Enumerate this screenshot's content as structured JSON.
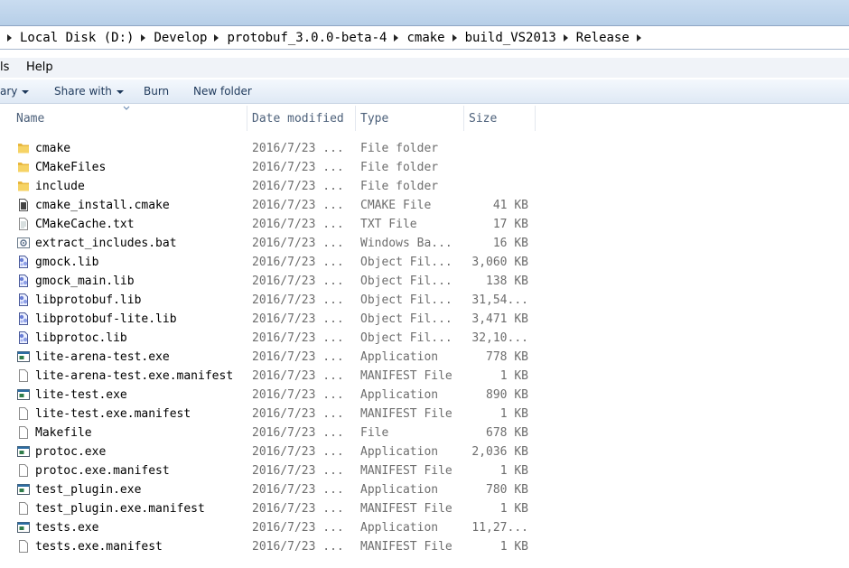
{
  "breadcrumb": [
    "Local Disk (D:)",
    "Develop",
    "protobuf_3.0.0-beta-4",
    "cmake",
    "build_VS2013",
    "Release"
  ],
  "menu": {
    "tools_partial": "ls",
    "help": "Help"
  },
  "toolbar": {
    "library_partial": "ary",
    "share_with": "Share with",
    "burn": "Burn",
    "new_folder": "New folder"
  },
  "columns": {
    "name": "Name",
    "date_modified": "Date modified",
    "type": "Type",
    "size": "Size"
  },
  "files": [
    {
      "name": "cmake",
      "date": "2016/7/23 ...",
      "type": "File folder",
      "size": "",
      "icon": "folder-icon"
    },
    {
      "name": "CMakeFiles",
      "date": "2016/7/23 ...",
      "type": "File folder",
      "size": "",
      "icon": "folder-icon"
    },
    {
      "name": "include",
      "date": "2016/7/23 ...",
      "type": "File folder",
      "size": "",
      "icon": "folder-icon"
    },
    {
      "name": "cmake_install.cmake",
      "date": "2016/7/23 ...",
      "type": "CMAKE File",
      "size": "41 KB",
      "icon": "cmake-file-icon"
    },
    {
      "name": "CMakeCache.txt",
      "date": "2016/7/23 ...",
      "type": "TXT File",
      "size": "17 KB",
      "icon": "text-file-icon"
    },
    {
      "name": "extract_includes.bat",
      "date": "2016/7/23 ...",
      "type": "Windows Ba...",
      "size": "16 KB",
      "icon": "batch-file-icon"
    },
    {
      "name": "gmock.lib",
      "date": "2016/7/23 ...",
      "type": "Object Fil...",
      "size": "3,060 KB",
      "icon": "lib-file-icon"
    },
    {
      "name": "gmock_main.lib",
      "date": "2016/7/23 ...",
      "type": "Object Fil...",
      "size": "138 KB",
      "icon": "lib-file-icon"
    },
    {
      "name": "libprotobuf.lib",
      "date": "2016/7/23 ...",
      "type": "Object Fil...",
      "size": "31,54...",
      "icon": "lib-file-icon"
    },
    {
      "name": "libprotobuf-lite.lib",
      "date": "2016/7/23 ...",
      "type": "Object Fil...",
      "size": "3,471 KB",
      "icon": "lib-file-icon"
    },
    {
      "name": "libprotoc.lib",
      "date": "2016/7/23 ...",
      "type": "Object Fil...",
      "size": "32,10...",
      "icon": "lib-file-icon"
    },
    {
      "name": "lite-arena-test.exe",
      "date": "2016/7/23 ...",
      "type": "Application",
      "size": "778 KB",
      "icon": "exe-icon"
    },
    {
      "name": "lite-arena-test.exe.manifest",
      "date": "2016/7/23 ...",
      "type": "MANIFEST File",
      "size": "1 KB",
      "icon": "blank-file-icon"
    },
    {
      "name": "lite-test.exe",
      "date": "2016/7/23 ...",
      "type": "Application",
      "size": "890 KB",
      "icon": "exe-icon"
    },
    {
      "name": "lite-test.exe.manifest",
      "date": "2016/7/23 ...",
      "type": "MANIFEST File",
      "size": "1 KB",
      "icon": "blank-file-icon"
    },
    {
      "name": "Makefile",
      "date": "2016/7/23 ...",
      "type": "File",
      "size": "678 KB",
      "icon": "blank-file-icon"
    },
    {
      "name": "protoc.exe",
      "date": "2016/7/23 ...",
      "type": "Application",
      "size": "2,036 KB",
      "icon": "exe-icon"
    },
    {
      "name": "protoc.exe.manifest",
      "date": "2016/7/23 ...",
      "type": "MANIFEST File",
      "size": "1 KB",
      "icon": "blank-file-icon"
    },
    {
      "name": "test_plugin.exe",
      "date": "2016/7/23 ...",
      "type": "Application",
      "size": "780 KB",
      "icon": "exe-icon"
    },
    {
      "name": "test_plugin.exe.manifest",
      "date": "2016/7/23 ...",
      "type": "MANIFEST File",
      "size": "1 KB",
      "icon": "blank-file-icon"
    },
    {
      "name": "tests.exe",
      "date": "2016/7/23 ...",
      "type": "Application",
      "size": "11,27...",
      "icon": "exe-icon"
    },
    {
      "name": "tests.exe.manifest",
      "date": "2016/7/23 ...",
      "type": "MANIFEST File",
      "size": "1 KB",
      "icon": "blank-file-icon"
    }
  ]
}
